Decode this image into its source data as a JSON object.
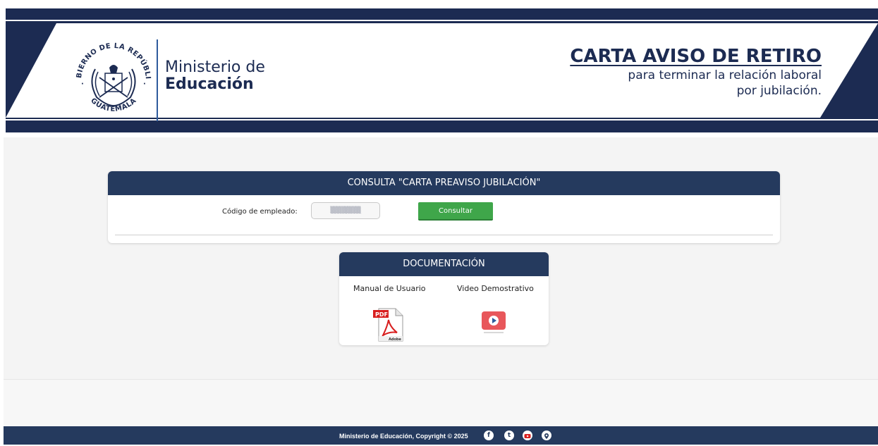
{
  "header": {
    "seal_top_text": "GOBIERNO DE LA REPÚBLICA",
    "seal_bottom_text": "GUATEMALA",
    "ministry_line1": "Ministerio de",
    "ministry_line2": "Educación",
    "title": "CARTA AVISO DE RETIRO",
    "subtitle_line1": "para terminar la relación laboral",
    "subtitle_line2": "por jubilación."
  },
  "consulta": {
    "heading": "CONSULTA \"CARTA PREAVISO JUBILACIÓN\"",
    "codigo_label": "Código de empleado:",
    "codigo_value": "▒▒▒▒▒▒▒▒",
    "button_label": "Consultar"
  },
  "documentacion": {
    "heading": "DOCUMENTACIÓN",
    "manual_label": "Manual de Usuario",
    "video_label": "Video Demostrativo",
    "pdf_badge": "PDF",
    "adobe_text": "Adobe"
  },
  "footer": {
    "copyright": "Ministerio de Educación, Copyright © 2025",
    "social": [
      "facebook-icon",
      "twitter-icon",
      "youtube-icon",
      "website-icon"
    ]
  },
  "colors": {
    "navy": "#253a5e",
    "banner_navy": "#1c2b52",
    "accent_blue": "#2e5b9c",
    "button_green": "#3fa64a",
    "pdf_red": "#d81e1e",
    "video_red": "#e8575b"
  }
}
